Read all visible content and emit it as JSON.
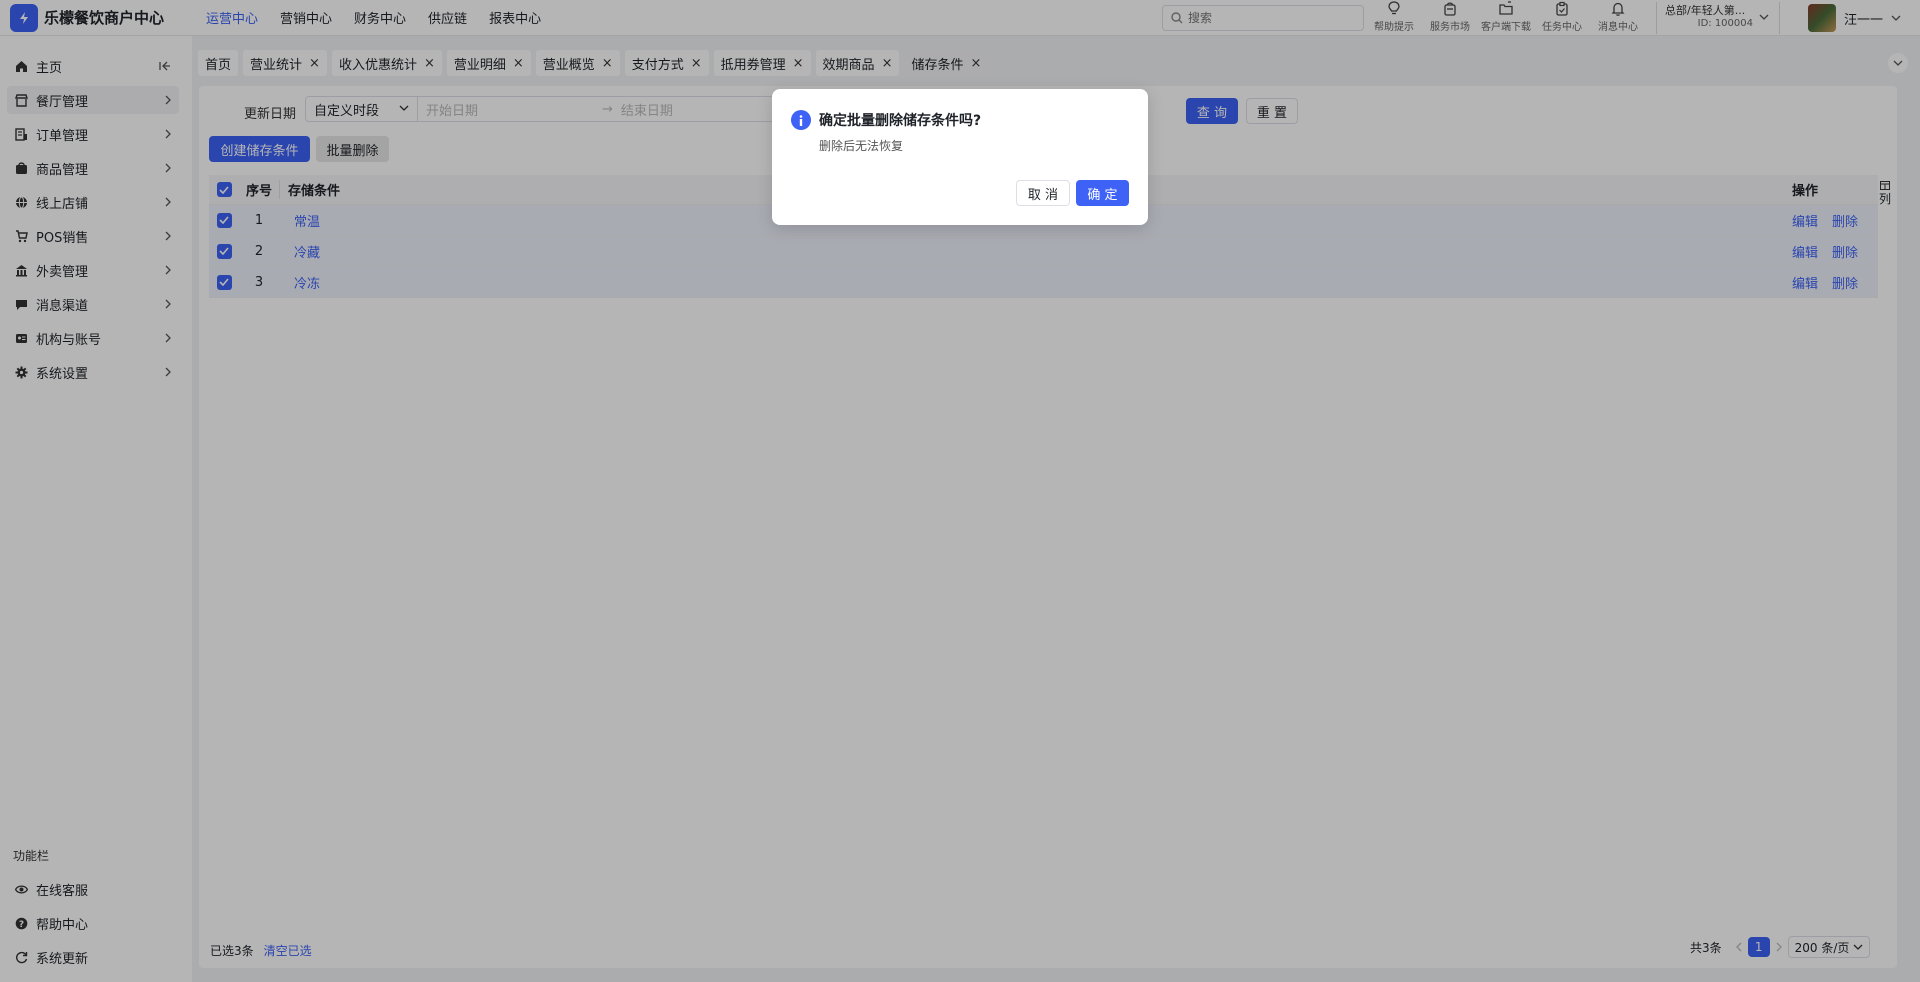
{
  "app": {
    "title": "乐檬餐饮商户中心"
  },
  "top_nav": [
    "运营中心",
    "营销中心",
    "财务中心",
    "供应链",
    "报表中心"
  ],
  "search": {
    "placeholder": "搜索"
  },
  "tools": [
    {
      "label": "帮助提示",
      "icon": "bulb-icon"
    },
    {
      "label": "服务市场",
      "icon": "shop-bag-icon"
    },
    {
      "label": "客户端下载",
      "icon": "folder-download-icon"
    },
    {
      "label": "任务中心",
      "icon": "clipboard-icon"
    },
    {
      "label": "消息中心",
      "icon": "bell-icon"
    }
  ],
  "org": {
    "name": "总部/年轻人第...",
    "id": "ID: 100004"
  },
  "user": {
    "name": "汪一一"
  },
  "sidebar": {
    "items": [
      {
        "label": "主页",
        "icon": "home-icon"
      },
      {
        "label": "餐厅管理",
        "icon": "store-icon"
      },
      {
        "label": "订单管理",
        "icon": "receipt-icon"
      },
      {
        "label": "商品管理",
        "icon": "box-icon"
      },
      {
        "label": "线上店铺",
        "icon": "globe-icon"
      },
      {
        "label": "POS销售",
        "icon": "cart-icon"
      },
      {
        "label": "外卖管理",
        "icon": "delivery-icon"
      },
      {
        "label": "消息渠道",
        "icon": "chat-icon"
      },
      {
        "label": "机构与账号",
        "icon": "id-card-icon"
      },
      {
        "label": "系统设置",
        "icon": "gear-icon"
      }
    ],
    "func_title": "功能栏",
    "func_items": [
      {
        "label": "在线客服",
        "icon": "eye-icon"
      },
      {
        "label": "帮助中心",
        "icon": "help-icon"
      },
      {
        "label": "系统更新",
        "icon": "refresh-icon"
      }
    ]
  },
  "tabs": [
    "首页",
    "营业统计",
    "收入优惠统计",
    "营业明细",
    "营业概览",
    "支付方式",
    "抵用券管理",
    "效期商品",
    "储存条件"
  ],
  "filter": {
    "label": "更新日期",
    "range_type": "自定义时段",
    "start_placeholder": "开始日期",
    "arrow": "→",
    "end_placeholder": "结束日期",
    "query": "查 询",
    "reset": "重 置"
  },
  "actions": {
    "create": "创建储存条件",
    "batch_delete": "批量删除"
  },
  "table": {
    "headers": {
      "no": "序号",
      "condition": "存储条件",
      "ops": "操作",
      "col_setting": "列"
    },
    "rows": [
      {
        "no": "1",
        "condition": "常温",
        "edit": "编辑",
        "delete": "删除"
      },
      {
        "no": "2",
        "condition": "冷藏",
        "edit": "编辑",
        "delete": "删除"
      },
      {
        "no": "3",
        "condition": "冷冻",
        "edit": "编辑",
        "delete": "删除"
      }
    ]
  },
  "footer": {
    "selected": "已选3条",
    "clear": "清空已选",
    "total": "共3条",
    "page": "1",
    "page_size": "200 条/页"
  },
  "modal": {
    "title": "确定批量删除储存条件吗?",
    "content": "删除后无法恢复",
    "cancel": "取 消",
    "ok": "确 定"
  },
  "colors": {
    "primary": "#3d62f5",
    "overlay": "rgba(0,0,0,0.29)"
  }
}
